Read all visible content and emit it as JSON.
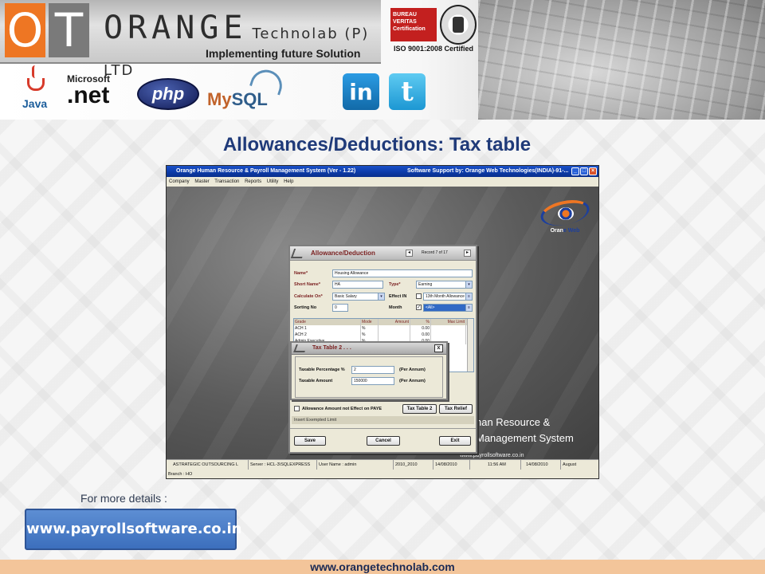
{
  "header": {
    "logo_o": "O",
    "logo_t": "T",
    "company_main": "ORANGE",
    "company_sub": "Technolab (P) LTD",
    "tagline": "Implementing future Solution",
    "cert_bv": "BUREAU VERITAS Certification",
    "cert_iso": "ISO 9001:2008 Certified",
    "tech_logos": [
      {
        "label": "Java",
        "icon": "java-icon"
      },
      {
        "label": "Microsoft",
        "icon": "dotnet-icon"
      },
      {
        "label": ".net",
        "icon": "dotnet-icon"
      },
      {
        "label": "php",
        "icon": "php-icon"
      },
      {
        "label_my": "My",
        "label_sql": "SQL",
        "icon": "mysql-icon"
      }
    ],
    "social": [
      {
        "label": "in",
        "icon": "linkedin-icon"
      },
      {
        "label": "t",
        "icon": "twitter-icon"
      }
    ]
  },
  "slide": {
    "title": "Allowances/Deductions: Tax table"
  },
  "app": {
    "window_title": "Orange Human Resource & Payroll Management System (Ver - 1.22)",
    "support_text": "Software Support by: Orange Web Technologies(INDIA)-91-...",
    "menu": [
      "Company",
      "Master",
      "Transaction",
      "Reports",
      "Utility",
      "Help"
    ],
    "logo_text_orange": "Oran",
    "logo_text_e": "e",
    "logo_text_web": " Web",
    "brand_line1": "nan  Resource  &",
    "brand_line2": "Management  System",
    "brand_url": "www.payrollsoftware.co.in",
    "dialog": {
      "title": "Allowance/Deduction",
      "record": "Record 7 of 17",
      "name_label": "Name*",
      "name_value": "Housing Allowance",
      "short_name_label": "Short Name*",
      "short_name_value": "HA",
      "type_label": "Type*",
      "type_value": "Earning",
      "calc_label": "Calculate On*",
      "calc_value": "Basic Salary",
      "effect_label": "Effect IN",
      "effect_value": "13th Month Allowance",
      "sorting_label": "Sorting No",
      "sorting_value": "0",
      "month_label": "Month",
      "month_value": "<All>",
      "grid_headers": [
        "Grade",
        "Mode",
        "Amount",
        "%",
        "Max Limit"
      ],
      "grid_rows": [
        [
          "ACH 1",
          "%",
          "",
          "0.00",
          ""
        ],
        [
          "ACH 2",
          "%",
          "",
          "0.00",
          ""
        ],
        [
          "Admin Executive",
          "%",
          "",
          "0.00",
          ""
        ]
      ],
      "tax_dialog": {
        "title": "Tax Table 2 . . .",
        "close": "x",
        "pct_label": "Taxable Percentage %",
        "pct_value": "2",
        "pct_unit": "(Per Annum)",
        "amt_label": "Taxable Amount",
        "amt_value": "150000",
        "amt_unit": "(Per Annum)"
      },
      "paye_label": "Allowance Amount not Effect on PAYE",
      "tax_table_btn": "Tax Table 2",
      "tax_relief_btn": "Tax Relief",
      "status_text": "Insert Exempted Limit",
      "save_btn": "Save",
      "cancel_btn": "Cancel",
      "exit_btn": "Exit"
    },
    "status_bar": [
      "ASTRATEGIC OUTSOURCING L",
      "Server : HCL-3\\SQLEXPRESS",
      "User Name : admin",
      "2010_2010",
      "14/08/2010",
      "11:56 AM",
      "14/08/2010",
      "August"
    ],
    "branch": "Branch : HO"
  },
  "footer": {
    "more_details": "For more details :",
    "button_url": "www.payrollsoftware.co.in",
    "bottom_url": "www.orangetechnolab.com"
  },
  "colors": {
    "orange": "#ee7623",
    "title_blue": "#1f3a79",
    "button_blue": "#3c6fbd",
    "footer_bar": "#f3c59a"
  }
}
